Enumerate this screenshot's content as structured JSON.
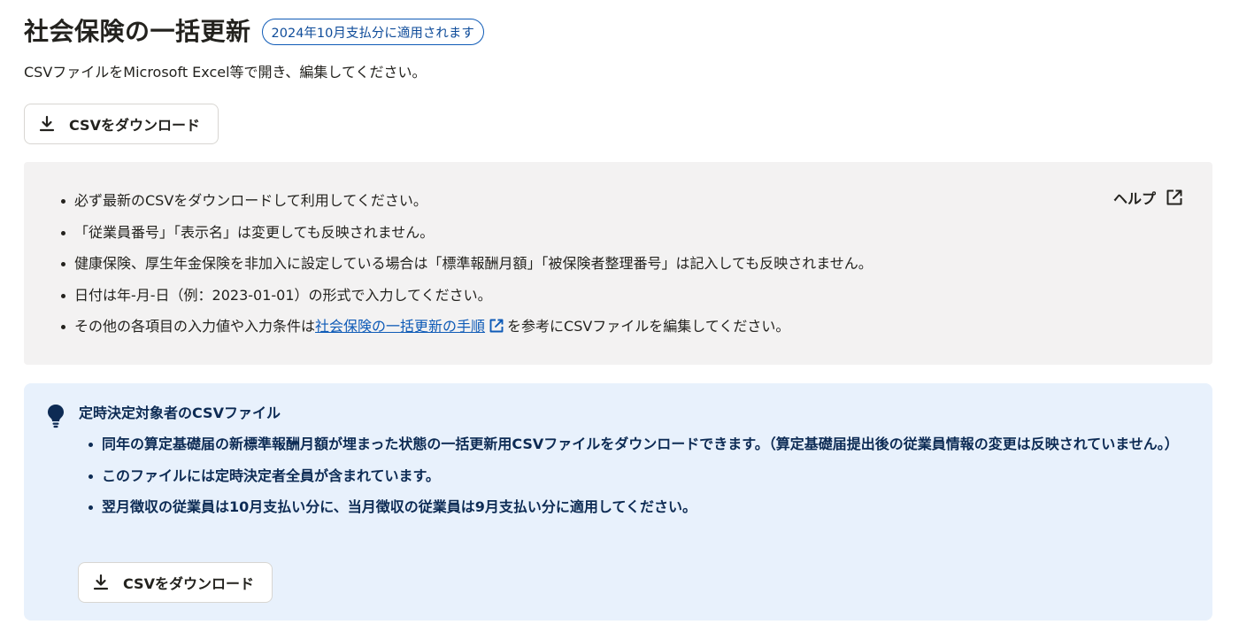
{
  "header": {
    "title": "社会保険の一括更新",
    "badge": "2024年10月支払分に適用されます",
    "subtitle": "CSVファイルをMicrosoft Excel等で開き、編集してください。"
  },
  "download_button": {
    "label": "CSVをダウンロード",
    "icon": "download-icon"
  },
  "notes": {
    "help_label": "ヘルプ",
    "help_icon": "external-link-icon",
    "items": [
      "必ず最新のCSVをダウンロードして利用してください。",
      "「従業員番号」「表示名」は変更しても反映されません。",
      "健康保険、厚生年金保険を非加入に設定している場合は「標準報酬月額」「被保険者整理番号」は記入しても反映されません。",
      "日付は年-月-日（例：2023-01-01）の形式で入力してください。"
    ],
    "last_item": {
      "prefix": "その他の各項目の入力値や入力条件は",
      "link_text": "社会保険の一括更新の手順",
      "suffix": "を参考にCSVファイルを編集してください。"
    }
  },
  "info_panel": {
    "icon": "lightbulb-icon",
    "title": "定時決定対象者のCSVファイル",
    "items": [
      "同年の算定基礎届の新標準報酬月額が埋まった状態の一括更新用CSVファイルをダウンロードできます。（算定基礎届提出後の従業員情報の変更は反映されていません。）",
      "このファイルには定時決定者全員が含まれています。",
      "翌月徴収の従業員は10月支払い分に、当月徴収の従業員は9月支払い分に適用してください。"
    ],
    "download_label": "CSVをダウンロード"
  },
  "colors": {
    "link": "#0f5bb7",
    "info_background": "#e8f1fc",
    "notes_background": "#f3f2f2",
    "info_text": "#0d2b54"
  }
}
